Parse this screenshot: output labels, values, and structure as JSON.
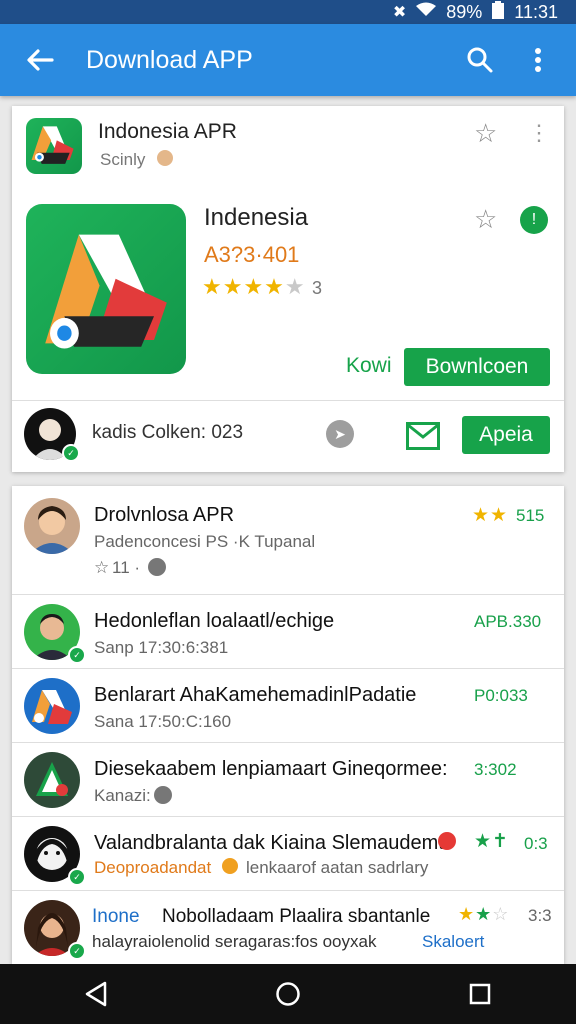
{
  "status": {
    "battery_pct": "89%",
    "time": "11:31"
  },
  "app_bar": {
    "title": "Download APP"
  },
  "header_app": {
    "name": "Indonesia APR",
    "dev": "Scinly"
  },
  "feature_app": {
    "name": "Indenesia",
    "code": "A3?3·401",
    "rating_count": "3",
    "rating": 4,
    "kowi_label": "Kowi",
    "download_label": "Bownlcoen"
  },
  "footer_row": {
    "text": "kadis Colken: 023",
    "apply_label": "Apeia"
  },
  "list": [
    {
      "title": "Drolvnlosa APR",
      "sub": "Padenconcesi PS ·K Tupanal",
      "meta": "11 ·",
      "right": "515"
    },
    {
      "title": "Hedonleflan loalaatl/echige",
      "sub": "Sanp 17:30:6:381",
      "right": "APB.330"
    },
    {
      "title": "Benlarart AhaKamehemadinlPadatie",
      "sub": "Sana 17:50:C:160",
      "right": "P0:033"
    },
    {
      "title": "Diesekaabem lenpiamaart Gineqormee:",
      "sub": "Kanazi:",
      "right": "3:302"
    },
    {
      "title": "Valandbralanta dak Kiaina Slemaudemt",
      "sub_orange": "Deoproadandat",
      "sub": "lenkaarof aatan sadrlary",
      "right": "0:3"
    },
    {
      "title_blue": "Inone",
      "title": "Nobolladaam Plaalira sbantanle",
      "sub": "halayraiolenolid seragaras:fos ooyxak",
      "sub_blue": "Skaloert",
      "right": "3:3"
    }
  ],
  "colors": {
    "status_bar": "#1f4e89",
    "app_bar": "#2b8be0",
    "green": "#17a34a",
    "star": "#f0b400"
  }
}
